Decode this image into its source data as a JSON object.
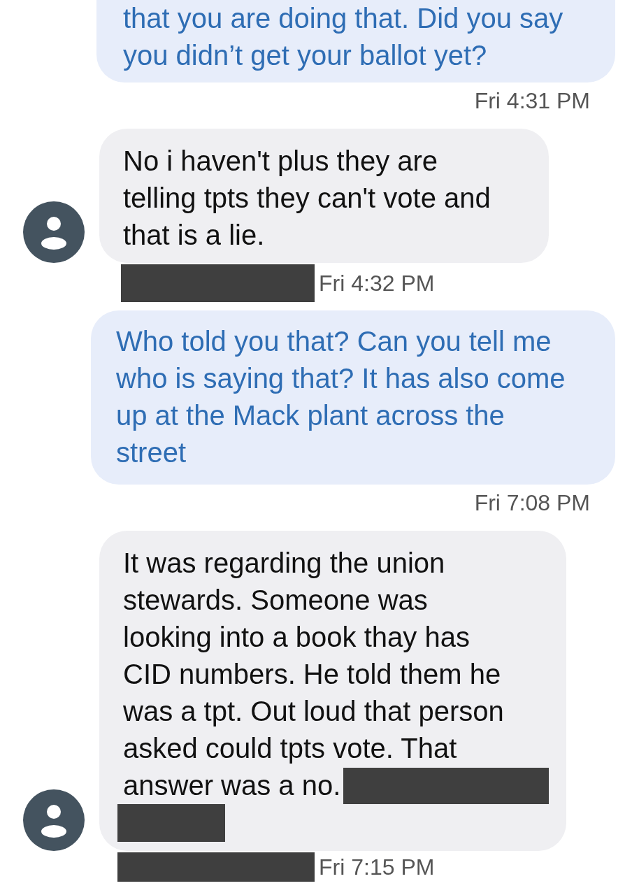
{
  "messages": [
    {
      "kind": "sent",
      "lines": [
        "that you are doing that. Did you say",
        "you didn’t get your ballot yet?"
      ],
      "time": "Fri 4:31 PM",
      "cut_top": true
    },
    {
      "kind": "received",
      "lines": [
        "No i haven't  plus they are",
        "telling tpts they can't vote and",
        "that is a lie."
      ],
      "time": "Fri 4:32 PM",
      "sender_redacted": true,
      "redacted_tail": false
    },
    {
      "kind": "sent",
      "lines": [
        "Who told you that? Can you tell me",
        "who is saying that? It has also come",
        "up at the Mack plant across the",
        "street"
      ],
      "time": "Fri 7:08 PM",
      "cut_top": false
    },
    {
      "kind": "received",
      "lines": [
        "It was regarding the union",
        "stewards.  Someone was",
        "looking into a book thay has",
        "CID numbers. He told them he",
        "was a tpt. Out loud that person",
        "asked could tpts vote. That",
        "answer was a no."
      ],
      "time": "Fri 7:15 PM",
      "sender_redacted": true,
      "redacted_tail": true
    }
  ]
}
